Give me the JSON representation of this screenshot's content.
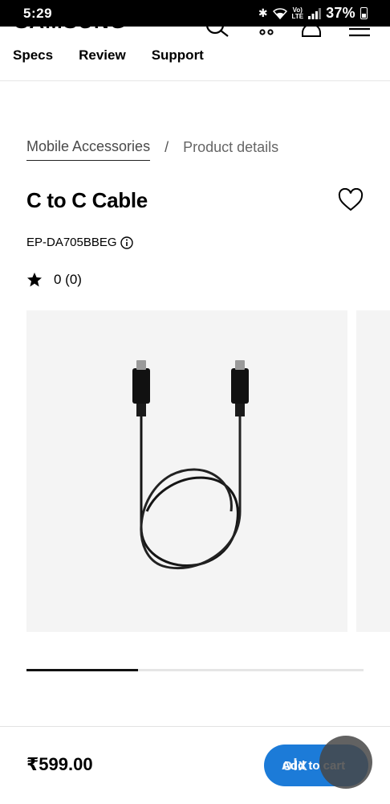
{
  "status_bar": {
    "time": "5:29",
    "battery_percent": "37%",
    "network_top": "Vo)",
    "network_bottom": "LTE"
  },
  "header": {
    "logo": "SAMSUNG",
    "subnav": [
      "Specs",
      "Review",
      "Support"
    ]
  },
  "breadcrumb": {
    "parent": "Mobile Accessories",
    "separator": "/",
    "current": "Product details"
  },
  "product": {
    "title": "C to C Cable",
    "sku": "EP-DA705BBEG",
    "rating": "0 (0)"
  },
  "gallery": {
    "progress_fraction": 0.33
  },
  "purchase": {
    "price": "₹599.00",
    "add_to_cart": "Add to cart"
  },
  "watermark": {
    "text": "olx"
  },
  "colors": {
    "accent": "#1c7bd8",
    "gallery_bg": "#f4f4f4"
  }
}
